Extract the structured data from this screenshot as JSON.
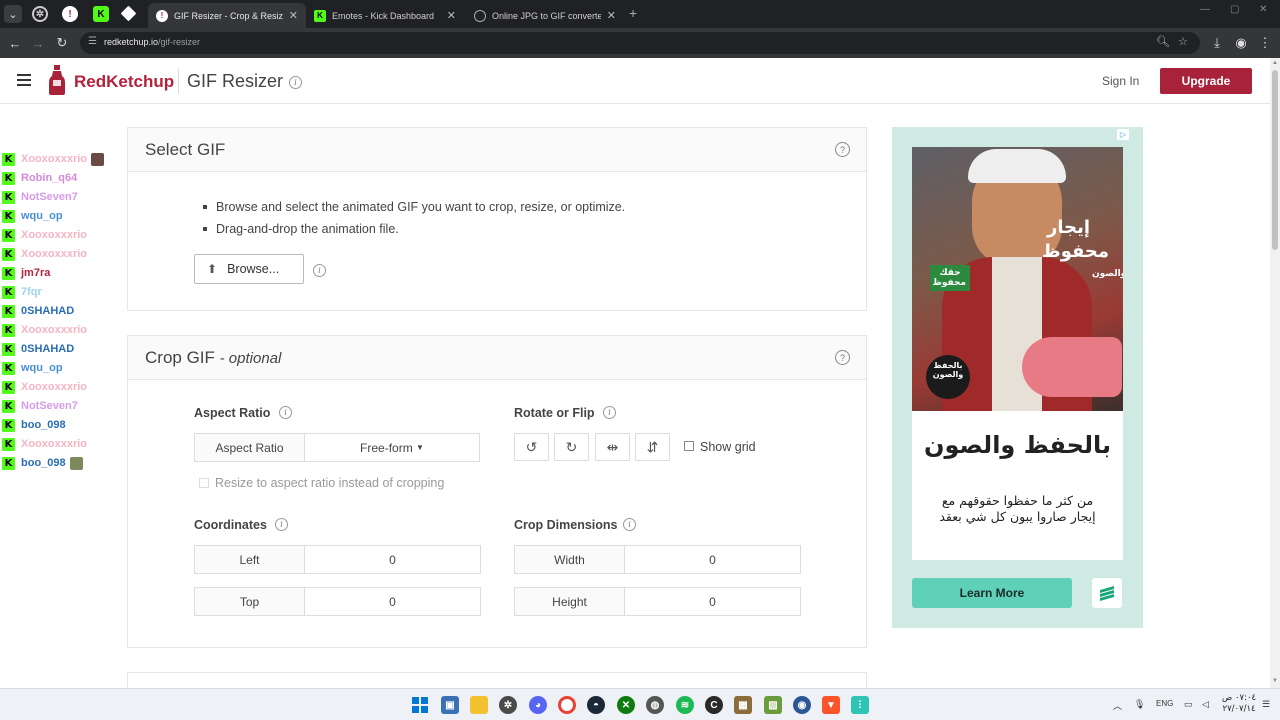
{
  "browser": {
    "tabs": [
      {
        "title": "GIF Resizer - Crop & Resize Ani",
        "active": true
      },
      {
        "title": "Emotes - Kick Dashboard",
        "active": false
      },
      {
        "title": "Online JPG to GIF converter",
        "active": false
      }
    ],
    "url_domain": "redketchup.io",
    "url_path": "/gif-resizer"
  },
  "header": {
    "brand": "RedKetchup",
    "page_title": "GIF Resizer",
    "sign_in": "Sign In",
    "upgrade": "Upgrade",
    "brand_color": "#a8223a"
  },
  "chat": {
    "users": [
      {
        "name": "Xooxoxxxrio",
        "color": "#f7b3c4",
        "avatar": true
      },
      {
        "name": "Robin_q64",
        "color": "#d48ad8",
        "avatar": false
      },
      {
        "name": "NotSeven7",
        "color": "#d79be8",
        "avatar": false
      },
      {
        "name": "wqu_op",
        "color": "#4a8fd6",
        "avatar": false
      },
      {
        "name": "Xooxoxxxrio",
        "color": "#f7b3c4",
        "avatar": false
      },
      {
        "name": "Xooxoxxxrio",
        "color": "#f7b3c4",
        "avatar": false
      },
      {
        "name": "jm7ra",
        "color": "#b5223a",
        "avatar": false
      },
      {
        "name": "7fqr",
        "color": "#9fd2e8",
        "avatar": false
      },
      {
        "name": "0SHAHAD",
        "color": "#2a6db5",
        "avatar": false
      },
      {
        "name": "Xooxoxxxrio",
        "color": "#f7b3c4",
        "avatar": false
      },
      {
        "name": "0SHAHAD",
        "color": "#2a6db5",
        "avatar": false
      },
      {
        "name": "wqu_op",
        "color": "#4a8fd6",
        "avatar": false
      },
      {
        "name": "Xooxoxxxrio",
        "color": "#f7b3c4",
        "avatar": false
      },
      {
        "name": "NotSeven7",
        "color": "#d79be8",
        "avatar": false
      },
      {
        "name": "boo_098",
        "color": "#2a6db5",
        "avatar": false
      },
      {
        "name": "Xooxoxxxrio",
        "color": "#f7b3c4",
        "avatar": false
      },
      {
        "name": "boo_098",
        "color": "#2a6db5",
        "avatar": true
      }
    ]
  },
  "select_gif": {
    "title": "Select GIF",
    "bullets": [
      "Browse and select the animated GIF you want to crop, resize, or optimize.",
      "Drag-and-drop the animation file."
    ],
    "browse_label": "Browse..."
  },
  "crop_gif": {
    "title": "Crop GIF",
    "subtitle": "- optional",
    "aspect_ratio_label": "Aspect Ratio",
    "aspect_ratio_field": "Aspect Ratio",
    "aspect_ratio_value": "Free-form",
    "resize_checkbox_label": "Resize to aspect ratio instead of cropping",
    "rotate_label": "Rotate or Flip",
    "show_grid_label": "Show grid",
    "coordinates_label": "Coordinates",
    "left_label": "Left",
    "left_value": "0",
    "top_label": "Top",
    "top_value": "0",
    "crop_dimensions_label": "Crop Dimensions",
    "width_label": "Width",
    "width_value": "0",
    "height_label": "Height",
    "height_value": "0"
  },
  "ad": {
    "headline": "بالحفظ والصون",
    "body_line1": "من كثر ما حفظوا حقوقهم مع",
    "body_line2": "إيجار صاروا يبون كل شي بعقد",
    "cta": "Learn More",
    "photo_text_1": "إيجار",
    "photo_text_2": "محفوظ",
    "photo_text_3": "والصون",
    "badge_text": "حقك محفوظ",
    "stamp_text": "بالحفظ والصون"
  },
  "taskbar": {
    "lang": "ENG",
    "time": "٠٧:٠٤ ص",
    "date": "٢٧/٠٧/١٤"
  }
}
